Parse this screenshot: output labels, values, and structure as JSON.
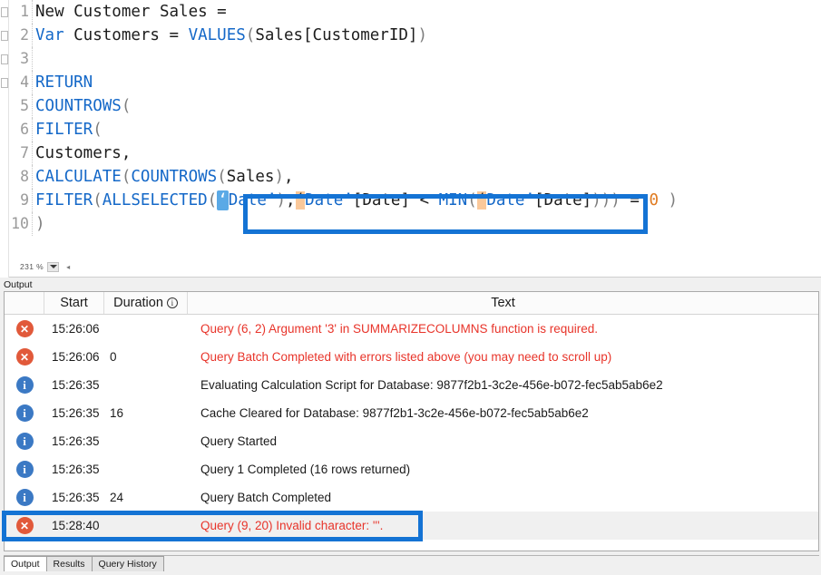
{
  "editor": {
    "zoom_level": "231 %",
    "lines": [
      {
        "num": "1",
        "tokens": [
          {
            "t": "New Customer Sales =",
            "c": "plain"
          }
        ]
      },
      {
        "num": "2",
        "tokens": [
          {
            "t": "Var",
            "c": "kw"
          },
          {
            "t": " Customers = ",
            "c": "plain"
          },
          {
            "t": "VALUES",
            "c": "fn"
          },
          {
            "t": "(",
            "c": "pun"
          },
          {
            "t": "Sales[CustomerID]",
            "c": "plain"
          },
          {
            "t": ")",
            "c": "pun"
          }
        ]
      },
      {
        "num": "3",
        "tokens": [
          {
            "t": "",
            "c": "plain"
          }
        ]
      },
      {
        "num": "4",
        "tokens": [
          {
            "t": "RETURN",
            "c": "kw"
          }
        ]
      },
      {
        "num": "5",
        "tokens": [
          {
            "t": "COUNTROWS",
            "c": "fn"
          },
          {
            "t": "(",
            "c": "pun"
          }
        ]
      },
      {
        "num": "6",
        "tokens": [
          {
            "t": "FILTER",
            "c": "fn"
          },
          {
            "t": "(",
            "c": "pun"
          }
        ]
      },
      {
        "num": "7",
        "tokens": [
          {
            "t": "Customers,",
            "c": "plain"
          }
        ]
      },
      {
        "num": "8",
        "tokens": [
          {
            "t": "CALCULATE",
            "c": "fn"
          },
          {
            "t": "(",
            "c": "pun"
          },
          {
            "t": "COUNTROWS",
            "c": "fn"
          },
          {
            "t": "(",
            "c": "pun"
          },
          {
            "t": "Sales",
            "c": "plain"
          },
          {
            "t": ")",
            "c": "pun"
          },
          {
            "t": ",",
            "c": "plain"
          }
        ]
      },
      {
        "num": "9",
        "tokens": [
          {
            "t": "FILTER",
            "c": "fn"
          },
          {
            "t": "(",
            "c": "pun"
          },
          {
            "t": "ALLSELECTED",
            "c": "fn"
          },
          {
            "t": "(",
            "c": "pun"
          },
          {
            "t": "‘",
            "c": "hl-blue"
          },
          {
            "t": "Date’",
            "c": "fn"
          },
          {
            "t": ")",
            "c": "pun"
          },
          {
            "t": ",",
            "c": "plain"
          },
          {
            "t": "‘",
            "c": "hl-orange"
          },
          {
            "t": "Date’",
            "c": "fn"
          },
          {
            "t": "[Date] < ",
            "c": "plain"
          },
          {
            "t": "MIN",
            "c": "fn"
          },
          {
            "t": "(",
            "c": "pun"
          },
          {
            "t": "‘",
            "c": "hl-orange"
          },
          {
            "t": "Date’",
            "c": "fn"
          },
          {
            "t": "[Date]",
            "c": "plain"
          },
          {
            "t": ")))",
            "c": "pun"
          },
          {
            "t": " = ",
            "c": "plain"
          },
          {
            "t": "0",
            "c": "num"
          },
          {
            "t": " )",
            "c": "pun"
          }
        ]
      },
      {
        "num": "10",
        "tokens": [
          {
            "t": ")",
            "c": "pun"
          }
        ]
      }
    ]
  },
  "output": {
    "caption": "Output",
    "columns": [
      "",
      "Start",
      "Duration",
      "Text"
    ],
    "duration_info_icon": "info-icon",
    "rows": [
      {
        "icon": "error-icon",
        "severity": "error",
        "start": "15:26:06",
        "duration": "",
        "text": "Query (6, 2) Argument '3' in SUMMARIZECOLUMNS function is required.",
        "selected": false
      },
      {
        "icon": "error-icon",
        "severity": "error",
        "start": "15:26:06",
        "duration": "0",
        "text": "Query Batch Completed with errors listed above (you may need to scroll up)",
        "selected": false
      },
      {
        "icon": "info-icon",
        "severity": "info",
        "start": "15:26:35",
        "duration": "",
        "text": "Evaluating Calculation Script for Database: 9877f2b1-3c2e-456e-b072-fec5ab5ab6e2",
        "selected": false
      },
      {
        "icon": "info-icon",
        "severity": "info",
        "start": "15:26:35",
        "duration": "16",
        "text": "Cache Cleared for Database: 9877f2b1-3c2e-456e-b072-fec5ab5ab6e2",
        "selected": false
      },
      {
        "icon": "info-icon",
        "severity": "info",
        "start": "15:26:35",
        "duration": "",
        "text": "Query Started",
        "selected": false
      },
      {
        "icon": "info-icon",
        "severity": "info",
        "start": "15:26:35",
        "duration": "",
        "text": "Query 1 Completed (16 rows returned)",
        "selected": false
      },
      {
        "icon": "info-icon",
        "severity": "info",
        "start": "15:26:35",
        "duration": "24",
        "text": "Query Batch Completed",
        "selected": false
      },
      {
        "icon": "error-icon",
        "severity": "error",
        "start": "15:28:40",
        "duration": "",
        "text": "Query (9, 20) Invalid character: '''.",
        "selected": true
      }
    ],
    "tabs": [
      {
        "label": "Output",
        "active": true
      },
      {
        "label": "Results",
        "active": false
      },
      {
        "label": "Query History",
        "active": false
      }
    ]
  },
  "annotations": {
    "accent_color": "#1473d4",
    "code_box_label": "highlighted-quote-characters",
    "row_box_label": "highlighted-invalid-character-error"
  }
}
